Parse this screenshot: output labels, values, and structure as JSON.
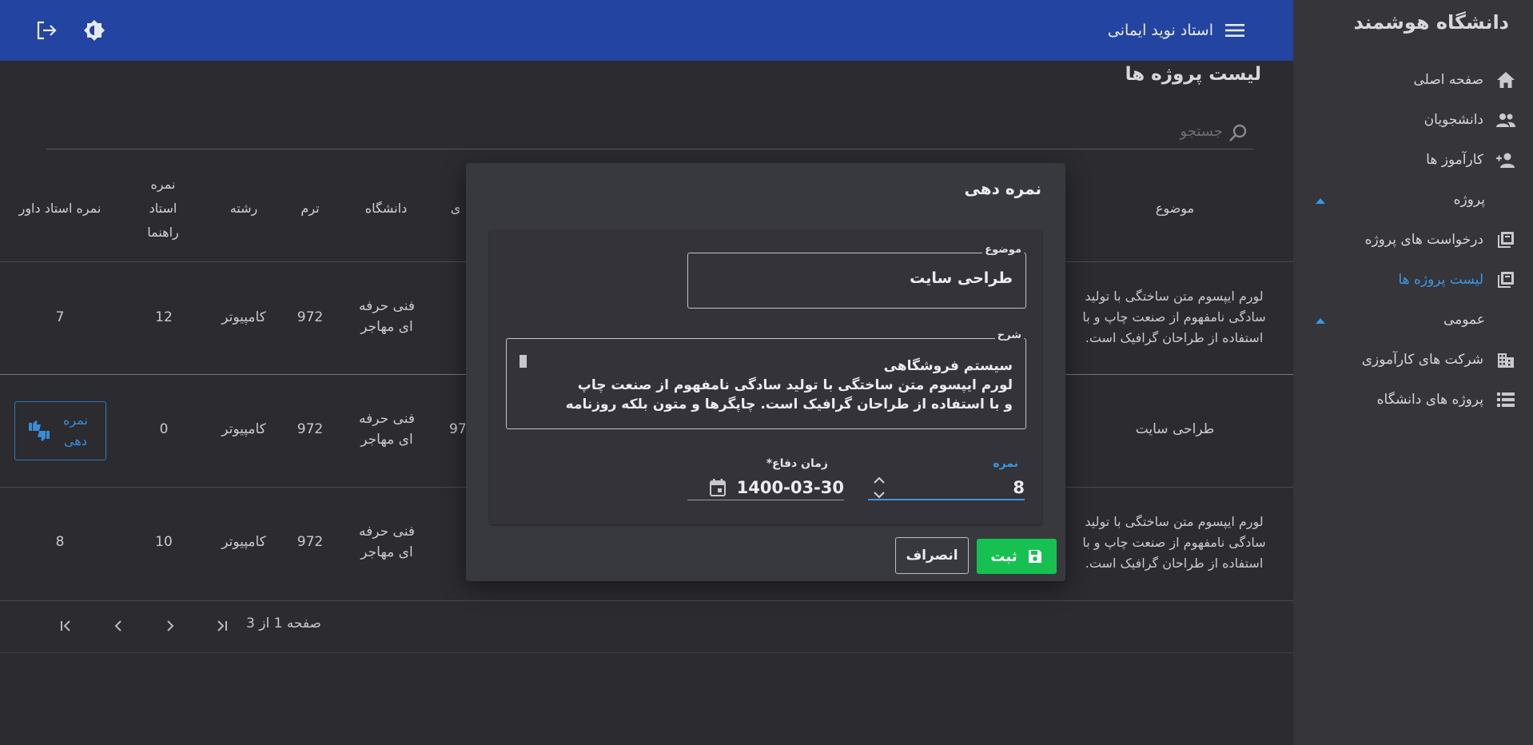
{
  "app": {
    "brand": "دانشگاه هوشمند",
    "user_name": "استاد نوید ایمانی"
  },
  "sidebar": {
    "items": [
      {
        "label": "صفحه اصلی",
        "icon": "home-icon"
      },
      {
        "label": "دانشجویان",
        "icon": "people-icon"
      },
      {
        "label": "کارآموز ها",
        "icon": "person-add-icon"
      },
      {
        "label": "درخواست های پروژه",
        "icon": "library-icon"
      },
      {
        "label": "لیست پروژه ها",
        "icon": "library-icon",
        "active": true
      },
      {
        "label": "شرکت های کارآموزی",
        "icon": "building-icon"
      },
      {
        "label": "پروژه های دانشگاه",
        "icon": "list-icon"
      }
    ],
    "sections": [
      "پروژه",
      "عمومی"
    ]
  },
  "main": {
    "title": "لیست پروژه ها",
    "search_placeholder": "جستجو",
    "table": {
      "headers": [
        "موضوع",
        "دانشگاه",
        "ترم",
        "رشته",
        "نمره استاد راهنما",
        "نمره استاد داور"
      ],
      "partial_header": "ی",
      "rows": [
        {
          "subject": "لورم ایپسوم متن ساختگی با تولید سادگی نامفهوم از صنعت چاپ و با استفاده از طراحان گرافیک است.",
          "university": "فنی حرفه ای مهاجر",
          "term": "972",
          "field": "کامپیوتر",
          "supervisor_grade": "12",
          "referee_grade": "7"
        },
        {
          "subject": "طراحی سایت",
          "university": "فنی حرفه ای مهاجر",
          "term": "972",
          "field": "کامپیوتر",
          "supervisor_grade": "0",
          "referee_grade": "",
          "partial": "97",
          "action_label": "نمره دهی"
        },
        {
          "subject": "لورم ایپسوم متن ساختگی با تولید سادگی نامفهوم از صنعت چاپ و با استفاده از طراحان گرافیک است.",
          "university": "فنی حرفه ای مهاجر",
          "term": "972",
          "field": "کامپیوتر",
          "supervisor_grade": "10",
          "referee_grade": "8"
        }
      ]
    },
    "pagination": {
      "text": "صفحه 1 از 3"
    }
  },
  "dialog": {
    "title": "نمره دهی",
    "subject_label": "موضوع",
    "subject_value": "طراحی سایت",
    "description_label": "شرح",
    "description_value": "سیستم فروشگاهی\nلورم ایپسوم متن ساختگی با تولید سادگی نامفهوم از صنعت چاپ و با استفاده از طراحان گرافیک است. چاپگرها و متون بلکه روزنامه و مجله در",
    "grade_label": "نمره",
    "grade_value": "8",
    "defense_date_label": "زمان دفاع*",
    "defense_date_value": "1400-03-30",
    "save_label": "ثبت",
    "cancel_label": "انصراف"
  },
  "colors": {
    "topbar": "#2344a0",
    "accent": "#3d97e2",
    "save": "#16c152",
    "background": "#2b2b30",
    "sidebar": "#35353a"
  }
}
